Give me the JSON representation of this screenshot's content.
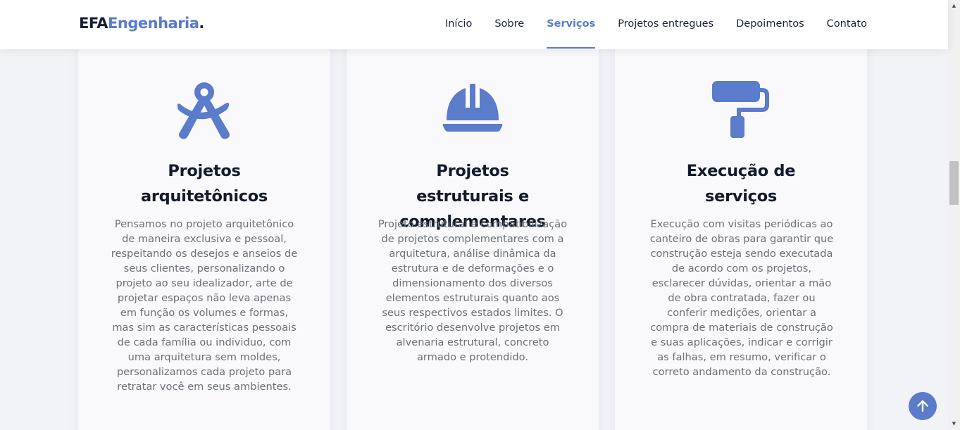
{
  "header": {
    "logo": {
      "part1": "EFA",
      "part2": "Engenharia",
      "part3": "."
    },
    "nav": [
      {
        "label": "Início",
        "active": false
      },
      {
        "label": "Sobre",
        "active": false
      },
      {
        "label": "Serviços",
        "active": true
      },
      {
        "label": "Projetos entregues",
        "active": false
      },
      {
        "label": "Depoimentos",
        "active": false
      },
      {
        "label": "Contato",
        "active": false
      }
    ]
  },
  "services": [
    {
      "icon": "drafting-compass-icon",
      "title": "Projetos arquitetônicos",
      "description": "Pensamos no projeto arquitetônico de maneira exclusiva e pessoal, respeitando os desejos e anseios de seus clientes, personalizando o projeto ao seu idealizador, arte de projetar espaços não leva apenas em função os volumes e formas, mas sim as características pessoais de cada família ou individuo, com uma arquitetura sem moldes, personalizamos cada projeto para retratar você em seus ambientes."
    },
    {
      "icon": "hard-hat-icon",
      "title": "Projetos estruturais e complementares",
      "description": "Projeto estrutural e compatibilização de projetos complementares com a arquitetura, análise dinâmica da estrutura e de deformações e o dimensionamento dos diversos elementos estruturais quanto aos seus respectivos estados limites. O escritório desenvolve projetos em alvenaria estrutural, concreto armado e protendido."
    },
    {
      "icon": "paint-roller-icon",
      "title": "Execução de serviços",
      "description": "Execução com visitas periódicas ao canteiro de obras para garantir que construção esteja sendo executada de acordo com os projetos, esclarecer dúvidas, orientar a mão de obra contratada, fazer ou conferir medições, orientar a compra de materiais de construção e suas aplicações, indicar e corrigir as falhas, em resumo, verificar o correto andamento da construção."
    }
  ],
  "colors": {
    "accent": "#5b7bcb",
    "heading": "#131a2b",
    "text": "#6b6f78"
  },
  "back_to_top_icon": "arrow-up-icon"
}
